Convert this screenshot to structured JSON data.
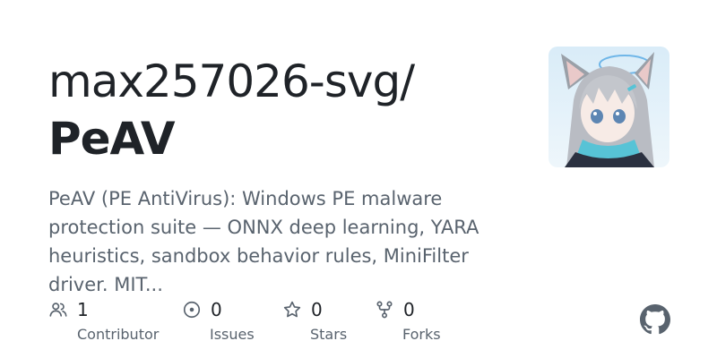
{
  "repo": {
    "owner": "max257026-svg/",
    "name": "PeAV",
    "description": "PeAV (PE AntiVirus): Windows PE malware protection suite — ONNX deep learning, YARA heuristics, sandbox behavior rules, MiniFilter driver. MIT..."
  },
  "avatar": {
    "icon": "anime-character-avatar"
  },
  "stats": [
    {
      "icon": "people-icon",
      "value": "1",
      "label": "Contributor"
    },
    {
      "icon": "issue-circle-icon",
      "value": "0",
      "label": "Issues"
    },
    {
      "icon": "star-icon",
      "value": "0",
      "label": "Stars"
    },
    {
      "icon": "fork-icon",
      "value": "0",
      "label": "Forks"
    }
  ],
  "brand": {
    "icon": "github-icon"
  },
  "colors": {
    "title": "#1f2328",
    "muted": "#59636e"
  }
}
